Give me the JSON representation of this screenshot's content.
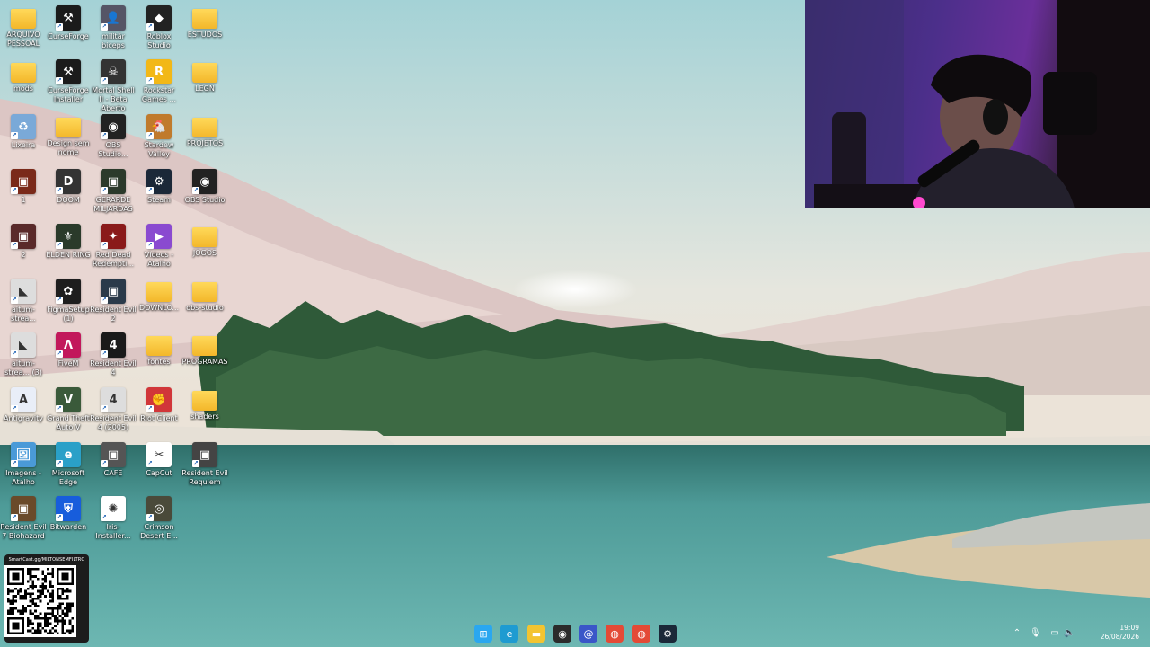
{
  "desktop": {
    "icons": [
      {
        "label": "ARQUIVO PESSOAL",
        "kind": "folder"
      },
      {
        "label": "CurseForge",
        "kind": "app",
        "color": "#1b1b1b",
        "glyph": "⚒"
      },
      {
        "label": "militär biceps",
        "kind": "app",
        "color": "#556",
        "glyph": "👤"
      },
      {
        "label": "Roblox Studio",
        "kind": "app",
        "color": "#222",
        "glyph": "◆"
      },
      {
        "label": "ESTUDOS",
        "kind": "folder"
      },
      {
        "label": "mods",
        "kind": "folder"
      },
      {
        "label": "CurseForge Installer",
        "kind": "app",
        "color": "#1b1b1b",
        "glyph": "⚒"
      },
      {
        "label": "Mortal Shell II - Beta Aberto",
        "kind": "app",
        "color": "#333",
        "glyph": "☠"
      },
      {
        "label": "Rockstar Games ...",
        "kind": "app",
        "color": "#f2b817",
        "glyph": "R"
      },
      {
        "label": "LEGN",
        "kind": "folder"
      },
      {
        "label": "Lixeira",
        "kind": "app",
        "color": "#7aa9d8",
        "glyph": "♻"
      },
      {
        "label": "Design sem nome",
        "kind": "folder"
      },
      {
        "label": "OBS Studio...",
        "kind": "app",
        "color": "#222",
        "glyph": "◉"
      },
      {
        "label": "Stardew Valley",
        "kind": "app",
        "color": "#c07a2c",
        "glyph": "🐔"
      },
      {
        "label": "PROJETOS",
        "kind": "folder"
      },
      {
        "label": "1",
        "kind": "app",
        "color": "#7a2a1a",
        "glyph": "▣"
      },
      {
        "label": "DOOM",
        "kind": "app",
        "color": "#333",
        "glyph": "D"
      },
      {
        "label": "GERARDE MILJARDAS",
        "kind": "app",
        "color": "#2b3a2b",
        "glyph": "▣"
      },
      {
        "label": "Steam",
        "kind": "app",
        "color": "#1b2838",
        "glyph": "⚙"
      },
      {
        "label": "OBS Studio",
        "kind": "app",
        "color": "#222",
        "glyph": "◉"
      },
      {
        "label": "2",
        "kind": "app",
        "color": "#5a2a2a",
        "glyph": "▣"
      },
      {
        "label": "ELDEN RING",
        "kind": "app",
        "color": "#2a3a2a",
        "glyph": "⚜"
      },
      {
        "label": "Red Dead Redempti...",
        "kind": "app",
        "color": "#8a1a1a",
        "glyph": "✦"
      },
      {
        "label": "Vídeos - Atalho",
        "kind": "app",
        "color": "#8a4ad0",
        "glyph": "▶"
      },
      {
        "label": "JOGOS",
        "kind": "folder"
      },
      {
        "label": "aitum-strea...",
        "kind": "app",
        "color": "#ddd",
        "glyph": "◣"
      },
      {
        "label": "FigmaSetup (1)",
        "kind": "app",
        "color": "#1e1e1e",
        "glyph": "✿"
      },
      {
        "label": "Resident Evil 2",
        "kind": "app",
        "color": "#2a3a4a",
        "glyph": "▣"
      },
      {
        "label": "DOWNLO...",
        "kind": "folder"
      },
      {
        "label": "obs-studio",
        "kind": "folder"
      },
      {
        "label": "aitum-strea... (3)",
        "kind": "app",
        "color": "#ddd",
        "glyph": "◣"
      },
      {
        "label": "FiveM",
        "kind": "app",
        "color": "#c2185b",
        "glyph": "Λ"
      },
      {
        "label": "Resident Evil 4",
        "kind": "app",
        "color": "#1a1a1a",
        "glyph": "4"
      },
      {
        "label": "fontes",
        "kind": "folder"
      },
      {
        "label": "PROGRAMAS",
        "kind": "folder"
      },
      {
        "label": "Antigravity",
        "kind": "app",
        "color": "#e9eef8",
        "glyph": "A"
      },
      {
        "label": "Grand Theft Auto V",
        "kind": "app",
        "color": "#3a5a3a",
        "glyph": "V"
      },
      {
        "label": "Resident Evil 4 (2005)",
        "kind": "app",
        "color": "#ddd",
        "glyph": "4"
      },
      {
        "label": "Riot Client",
        "kind": "app",
        "color": "#d13639",
        "glyph": "✊"
      },
      {
        "label": "shaders",
        "kind": "folder"
      },
      {
        "label": "Imagens - Atalho",
        "kind": "app",
        "color": "#4a9ad8",
        "glyph": "🖼"
      },
      {
        "label": "Microsoft Edge",
        "kind": "app",
        "color": "#2aa0c8",
        "glyph": "e"
      },
      {
        "label": "CAFE",
        "kind": "app",
        "color": "#555",
        "glyph": "▣"
      },
      {
        "label": "CapCut",
        "kind": "app",
        "color": "#fff",
        "glyph": "✂"
      },
      {
        "label": "Resident Evil Requiem",
        "kind": "app",
        "color": "#444",
        "glyph": "▣"
      },
      {
        "label": "Resident Evil 7 Biohazard",
        "kind": "app",
        "color": "#6a4a2a",
        "glyph": "▣"
      },
      {
        "label": "Bitwarden",
        "kind": "app",
        "color": "#175ddc",
        "glyph": "⛨"
      },
      {
        "label": "Iris-Installer...",
        "kind": "app",
        "color": "#fff",
        "glyph": "✺"
      },
      {
        "label": "Crimson Desert E...",
        "kind": "app",
        "color": "#4a4a3a",
        "glyph": "◎"
      }
    ]
  },
  "qr": {
    "label": "SmartCast.gg/MILTONSEMFILTRO"
  },
  "taskbar": {
    "apps": [
      {
        "name": "start-button",
        "glyph": "⊞",
        "color": "#2aa7f0"
      },
      {
        "name": "edge-taskbar",
        "glyph": "e",
        "color": "#1f9bd1"
      },
      {
        "name": "explorer-taskbar",
        "glyph": "▬",
        "color": "#f3c431"
      },
      {
        "name": "obs-taskbar",
        "glyph": "◉",
        "color": "#2b2b2b"
      },
      {
        "name": "app-taskbar",
        "glyph": "@",
        "color": "#3a56c8"
      },
      {
        "name": "chrome-taskbar",
        "glyph": "◍",
        "color": "#e44a36"
      },
      {
        "name": "chrome-profile-taskbar",
        "glyph": "◍",
        "color": "#e44a36"
      },
      {
        "name": "steam-taskbar",
        "glyph": "⚙",
        "color": "#1b2838"
      }
    ],
    "clock": {
      "time": "19:09",
      "date": "26/08/2026"
    }
  }
}
